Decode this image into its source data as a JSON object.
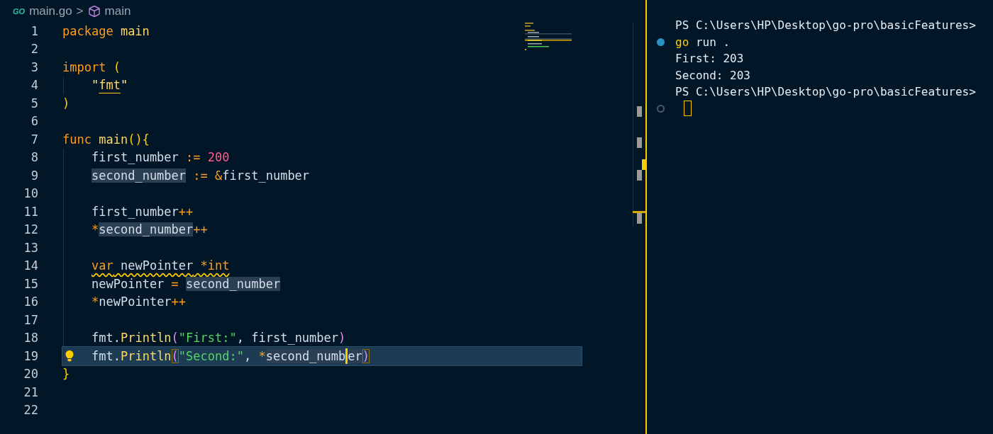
{
  "breadcrumb": {
    "file_icon_text": "GO",
    "file": "main.go",
    "separator": ">",
    "symbol": "main"
  },
  "editor": {
    "lines": [
      {
        "number": "1",
        "current": false,
        "indented": false,
        "tokens": [
          {
            "text": "package",
            "kind": "keyword"
          },
          {
            "text": " main",
            "kind": "name"
          }
        ]
      },
      {
        "number": "2",
        "current": false,
        "indented": false
      },
      {
        "number": "3",
        "current": false,
        "indented": false,
        "tokens": [
          {
            "text": "import",
            "kind": "keyword"
          },
          {
            "text": " (",
            "kind": "bracket"
          }
        ]
      },
      {
        "number": "4",
        "current": false,
        "indented": true,
        "tokens": [
          {
            "text": "\"",
            "kind": "quote"
          },
          {
            "text": "fmt",
            "kind": "name",
            "underline": true
          },
          {
            "text": "\"",
            "kind": "quote"
          }
        ]
      },
      {
        "number": "5",
        "current": false,
        "indented": false,
        "tokens": [
          {
            "text": ")",
            "kind": "bracket"
          }
        ]
      },
      {
        "number": "6",
        "current": false,
        "indented": false
      },
      {
        "number": "7",
        "current": false,
        "indented": false,
        "tokens": [
          {
            "text": "func",
            "kind": "keyword"
          },
          {
            "text": " main",
            "kind": "name"
          },
          {
            "text": "(){",
            "kind": "bracket"
          }
        ]
      },
      {
        "number": "8",
        "current": false,
        "indented": true,
        "tokens": [
          {
            "text": "first_number",
            "kind": "plain"
          },
          {
            "text": " :=",
            "kind": "keyword"
          },
          {
            "text": " 200",
            "kind": "number"
          }
        ]
      },
      {
        "number": "9",
        "current": false,
        "indented": true,
        "tokens": [
          {
            "text": "second_number",
            "kind": "plain",
            "highlighted": true
          },
          {
            "text": " :=",
            "kind": "keyword"
          },
          {
            "text": " &",
            "kind": "keyword"
          },
          {
            "text": "first_number",
            "kind": "plain"
          }
        ]
      },
      {
        "number": "10",
        "current": false,
        "indented": true
      },
      {
        "number": "11",
        "current": false,
        "indented": true,
        "tokens": [
          {
            "text": "first_number",
            "kind": "plain"
          },
          {
            "text": "++",
            "kind": "keyword"
          }
        ]
      },
      {
        "number": "12",
        "current": false,
        "indented": true,
        "tokens": [
          {
            "text": "*",
            "kind": "keyword"
          },
          {
            "text": "second_number",
            "kind": "plain",
            "highlighted": true
          },
          {
            "text": "++",
            "kind": "keyword"
          }
        ]
      },
      {
        "number": "13",
        "current": false,
        "indented": true
      },
      {
        "number": "14",
        "current": false,
        "indented": true,
        "tokens": [
          {
            "text": "var",
            "kind": "keyword",
            "squiggle": true
          },
          {
            "text": " newPointer",
            "kind": "plain",
            "squiggle": true
          },
          {
            "text": " *int",
            "kind": "keyword",
            "squiggle": true
          }
        ]
      },
      {
        "number": "15",
        "current": false,
        "indented": true,
        "tokens": [
          {
            "text": "newPointer",
            "kind": "plain"
          },
          {
            "text": " = ",
            "kind": "keyword"
          },
          {
            "text": "second_number",
            "kind": "plain",
            "highlighted": true
          }
        ]
      },
      {
        "number": "16",
        "current": false,
        "indented": true,
        "tokens": [
          {
            "text": "*",
            "kind": "keyword"
          },
          {
            "text": "newPointer",
            "kind": "plain"
          },
          {
            "text": "++",
            "kind": "keyword"
          }
        ]
      },
      {
        "number": "17",
        "current": false,
        "indented": true
      },
      {
        "number": "18",
        "current": false,
        "indented": true,
        "tokens": [
          {
            "text": "fmt.",
            "kind": "plain"
          },
          {
            "text": "Println",
            "kind": "name"
          },
          {
            "text": "(",
            "kind": "paren"
          },
          {
            "text": "\"First:\"",
            "kind": "string"
          },
          {
            "text": ", first_number",
            "kind": "plain"
          },
          {
            "text": ")",
            "kind": "paren"
          }
        ]
      },
      {
        "number": "19",
        "current": true,
        "indented": true,
        "lightbulb": true,
        "tokens": [
          {
            "text": "fmt.",
            "kind": "plain"
          },
          {
            "text": "Println",
            "kind": "name"
          },
          {
            "text": "(",
            "kind": "paren",
            "bracket_match": true
          },
          {
            "text": "\"Second:\"",
            "kind": "string"
          },
          {
            "text": ", ",
            "kind": "plain"
          },
          {
            "text": "*",
            "kind": "keyword"
          },
          {
            "text": "second_numb",
            "kind": "plain",
            "highlighted": true,
            "cursor": true
          },
          {
            "text": "er",
            "kind": "plain",
            "highlighted": true
          },
          {
            "text": ")",
            "kind": "paren",
            "bracket_match": true
          }
        ]
      },
      {
        "number": "20",
        "current": false,
        "indented": false,
        "tokens": [
          {
            "text": "}",
            "kind": "bracket"
          }
        ]
      },
      {
        "number": "21",
        "current": false,
        "indented": false
      },
      {
        "number": "22",
        "current": false,
        "indented": false
      }
    ]
  },
  "terminal": {
    "lines": [
      {
        "kind": "prompt",
        "text": "PS C:\\Users\\HP\\Desktop\\go-pro\\basicFeatures>"
      },
      {
        "kind": "command",
        "succeeded": true,
        "program": "go",
        "args": "run ."
      },
      {
        "kind": "output",
        "text": "First: 203"
      },
      {
        "kind": "output",
        "text": "Second: 203"
      },
      {
        "kind": "prompt",
        "text": "PS C:\\Users\\HP\\Desktop\\go-pro\\basicFeatures>"
      },
      {
        "kind": "input"
      }
    ]
  }
}
